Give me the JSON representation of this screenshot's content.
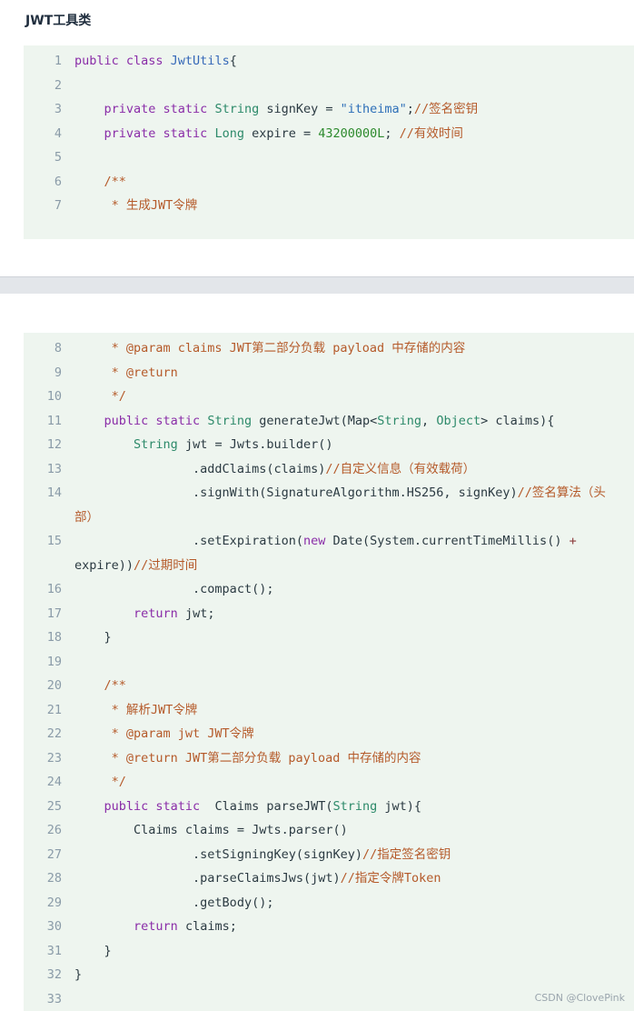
{
  "section_title": "JWT工具类",
  "watermark": "CSDN @ClovePink",
  "block1": [
    {
      "n": "1",
      "segs": [
        [
          "kw",
          "public class "
        ],
        [
          "cls",
          "JwtUtils"
        ],
        [
          "",
          "{"
        ]
      ]
    },
    {
      "n": "2",
      "segs": []
    },
    {
      "n": "3",
      "segs": [
        [
          "",
          "    "
        ],
        [
          "kw",
          "private static "
        ],
        [
          "ty",
          "String"
        ],
        [
          "",
          " signKey = "
        ],
        [
          "str",
          "\"itheima\""
        ],
        [
          "",
          ";"
        ],
        [
          "cm",
          "//签名密钥"
        ]
      ]
    },
    {
      "n": "4",
      "segs": [
        [
          "",
          "    "
        ],
        [
          "kw",
          "private static "
        ],
        [
          "ty",
          "Long"
        ],
        [
          "",
          " expire = "
        ],
        [
          "num",
          "43200000L"
        ],
        [
          "",
          "; "
        ],
        [
          "cm",
          "//有效时间"
        ]
      ]
    },
    {
      "n": "5",
      "segs": []
    },
    {
      "n": "6",
      "segs": [
        [
          "",
          "    "
        ],
        [
          "cm",
          "/**"
        ]
      ]
    },
    {
      "n": "7",
      "segs": [
        [
          "",
          "     "
        ],
        [
          "cm",
          "* 生成JWT令牌"
        ]
      ]
    }
  ],
  "block2": [
    {
      "n": "8",
      "segs": [
        [
          "",
          "     "
        ],
        [
          "cm",
          "* @param claims JWT第二部分负载 payload 中存储的内容"
        ]
      ]
    },
    {
      "n": "9",
      "segs": [
        [
          "",
          "     "
        ],
        [
          "cm",
          "* @return"
        ]
      ]
    },
    {
      "n": "10",
      "segs": [
        [
          "",
          "     "
        ],
        [
          "cm",
          "*/"
        ]
      ]
    },
    {
      "n": "11",
      "segs": [
        [
          "",
          "    "
        ],
        [
          "kw",
          "public static "
        ],
        [
          "ty",
          "String"
        ],
        [
          "",
          " generateJwt(Map<"
        ],
        [
          "ty",
          "String"
        ],
        [
          "",
          ", "
        ],
        [
          "ty",
          "Object"
        ],
        [
          "",
          "> claims){"
        ]
      ]
    },
    {
      "n": "12",
      "segs": [
        [
          "",
          "        "
        ],
        [
          "ty",
          "String"
        ],
        [
          "",
          " jwt = Jwts.builder()"
        ]
      ]
    },
    {
      "n": "13",
      "segs": [
        [
          "",
          "                .addClaims(claims)"
        ],
        [
          "cm",
          "//自定义信息（有效载荷）"
        ]
      ]
    },
    {
      "n": "14",
      "segs": [
        [
          "",
          "                .signWith(SignatureAlgorithm.HS256, signKey)"
        ],
        [
          "cm",
          "//签名算法（头部）"
        ]
      ]
    },
    {
      "n": "15",
      "segs": [
        [
          "",
          "                .setExpiration("
        ],
        [
          "kw",
          "new"
        ],
        [
          "",
          " Date(System.currentTimeMillis() "
        ],
        [
          "op",
          "+"
        ],
        [
          "",
          " expire))"
        ],
        [
          "cm",
          "//过期时间"
        ]
      ]
    },
    {
      "n": "16",
      "segs": [
        [
          "",
          "                .compact();"
        ]
      ]
    },
    {
      "n": "17",
      "segs": [
        [
          "",
          "        "
        ],
        [
          "kw",
          "return"
        ],
        [
          "",
          " jwt;"
        ]
      ]
    },
    {
      "n": "18",
      "segs": [
        [
          "",
          "    }"
        ]
      ]
    },
    {
      "n": "19",
      "segs": []
    },
    {
      "n": "20",
      "segs": [
        [
          "",
          "    "
        ],
        [
          "cm",
          "/**"
        ]
      ]
    },
    {
      "n": "21",
      "segs": [
        [
          "",
          "     "
        ],
        [
          "cm",
          "* 解析JWT令牌"
        ]
      ]
    },
    {
      "n": "22",
      "segs": [
        [
          "",
          "     "
        ],
        [
          "cm",
          "* @param jwt JWT令牌"
        ]
      ]
    },
    {
      "n": "23",
      "segs": [
        [
          "",
          "     "
        ],
        [
          "cm",
          "* @return JWT第二部分负载 payload 中存储的内容"
        ]
      ]
    },
    {
      "n": "24",
      "segs": [
        [
          "",
          "     "
        ],
        [
          "cm",
          "*/"
        ]
      ]
    },
    {
      "n": "25",
      "segs": [
        [
          "",
          "    "
        ],
        [
          "kw",
          "public static "
        ],
        [
          "",
          " Claims parseJWT("
        ],
        [
          "ty",
          "String"
        ],
        [
          "",
          " jwt){"
        ]
      ]
    },
    {
      "n": "26",
      "segs": [
        [
          "",
          "        Claims claims = Jwts.parser()"
        ]
      ]
    },
    {
      "n": "27",
      "segs": [
        [
          "",
          "                .setSigningKey(signKey)"
        ],
        [
          "cm",
          "//指定签名密钥"
        ]
      ]
    },
    {
      "n": "28",
      "segs": [
        [
          "",
          "                .parseClaimsJws(jwt)"
        ],
        [
          "cm",
          "//指定令牌Token"
        ]
      ]
    },
    {
      "n": "29",
      "segs": [
        [
          "",
          "                .getBody();"
        ]
      ]
    },
    {
      "n": "30",
      "segs": [
        [
          "",
          "        "
        ],
        [
          "kw",
          "return"
        ],
        [
          "",
          " claims;"
        ]
      ]
    },
    {
      "n": "31",
      "segs": [
        [
          "",
          "    }"
        ]
      ]
    },
    {
      "n": "32",
      "segs": [
        [
          "",
          "}"
        ]
      ]
    },
    {
      "n": "33",
      "segs": []
    }
  ]
}
